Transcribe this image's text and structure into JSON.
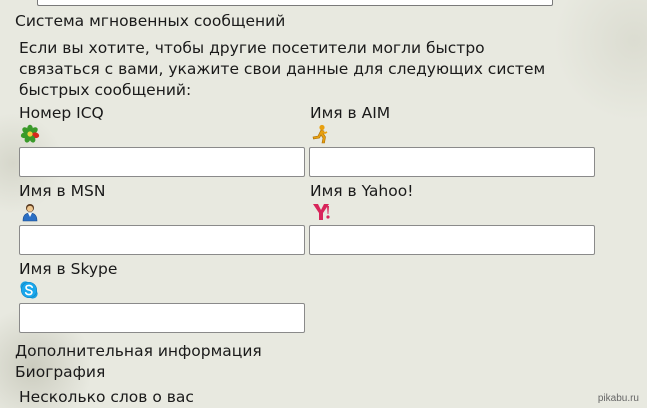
{
  "section_title": "Система мгновенных сообщений",
  "intro_lines": [
    "Если вы хотите, чтобы другие посетители могли быстро",
    "связаться с вами, укажите свои данные для следующих систем",
    "быстрых сообщений:"
  ],
  "fields": {
    "icq": {
      "label": "Номер ICQ",
      "value": "",
      "icon": "icq-flower-icon"
    },
    "aim": {
      "label": "Имя в AIM",
      "value": "",
      "icon": "aim-running-man-icon"
    },
    "msn": {
      "label": "Имя в MSN",
      "value": "",
      "icon": "msn-buddy-icon"
    },
    "yahoo": {
      "label": "Имя в Yahoo!",
      "value": "",
      "icon": "yahoo-y-icon"
    },
    "skype": {
      "label": "Имя в Skype",
      "value": "",
      "icon": "skype-icon"
    }
  },
  "additional_info": "Дополнительная информация",
  "biography": "Биография",
  "about_prompt": "Несколько слов о вас",
  "watermark": "pikabu.ru"
}
